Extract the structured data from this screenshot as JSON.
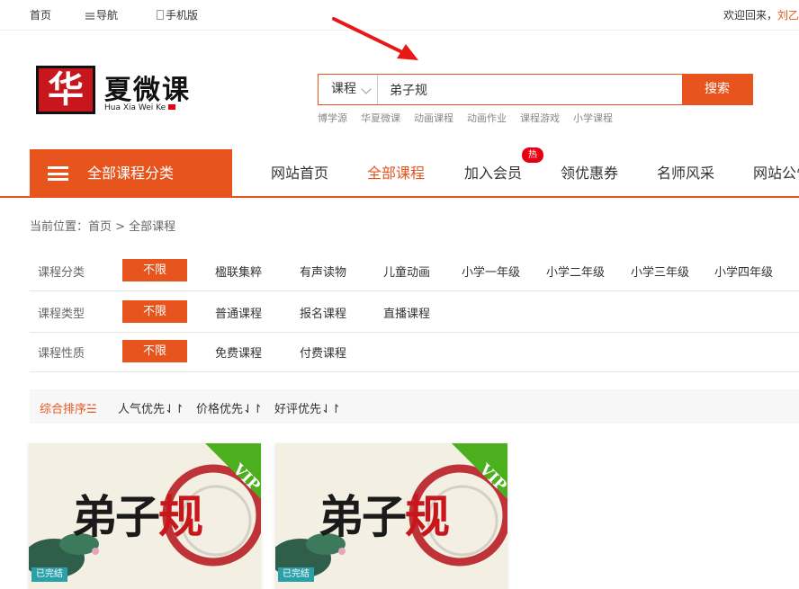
{
  "topbar": {
    "home": "首页",
    "nav": "导航",
    "mobile": "手机版",
    "welcome": "欢迎回来，",
    "username": "刘乙"
  },
  "logo": {
    "seal_char": "华",
    "brand_text": "夏微课",
    "sub_text": "Hua Xia Wei Ke"
  },
  "search": {
    "category": "课程",
    "query": "弟子规",
    "button": "搜索",
    "hot_links": [
      "博学源",
      "华夏微课",
      "动画课程",
      "动画作业",
      "课程游戏",
      "小学课程"
    ]
  },
  "mainnav": {
    "all_categories": "全部课程分类",
    "links": [
      "网站首页",
      "全部课程",
      "加入会员",
      "领优惠券",
      "名师风采",
      "网站公告"
    ],
    "active_index": 1,
    "hot_badge": "热"
  },
  "breadcrumb": "当前位置：首页 > 全部课程",
  "filters": [
    {
      "label": "课程分类",
      "selected": "不限",
      "options": [
        "楹联集粹",
        "有声读物",
        "儿童动画",
        "小学一年级",
        "小学二年级",
        "小学三年级",
        "小学四年级"
      ]
    },
    {
      "label": "课程类型",
      "selected": "不限",
      "options": [
        "普通课程",
        "报名课程",
        "直播课程"
      ]
    },
    {
      "label": "课程性质",
      "selected": "不限",
      "options": [
        "免费课程",
        "付费课程"
      ]
    }
  ],
  "sort": {
    "items": [
      "综合排序☱",
      "人气优先⇃↾",
      "价格优先⇃↾",
      "好评优先⇃↾"
    ],
    "active_index": 0
  },
  "cards": [
    {
      "title_black": "弟子",
      "title_red": "规",
      "badge": "VIP",
      "status": "已完结"
    },
    {
      "title_black": "弟子",
      "title_red": "规",
      "badge": "VIP",
      "status": "已完结"
    }
  ],
  "colors": {
    "accent": "#e8541e",
    "vip": "#4caf1e",
    "status": "#2aa0a8"
  }
}
